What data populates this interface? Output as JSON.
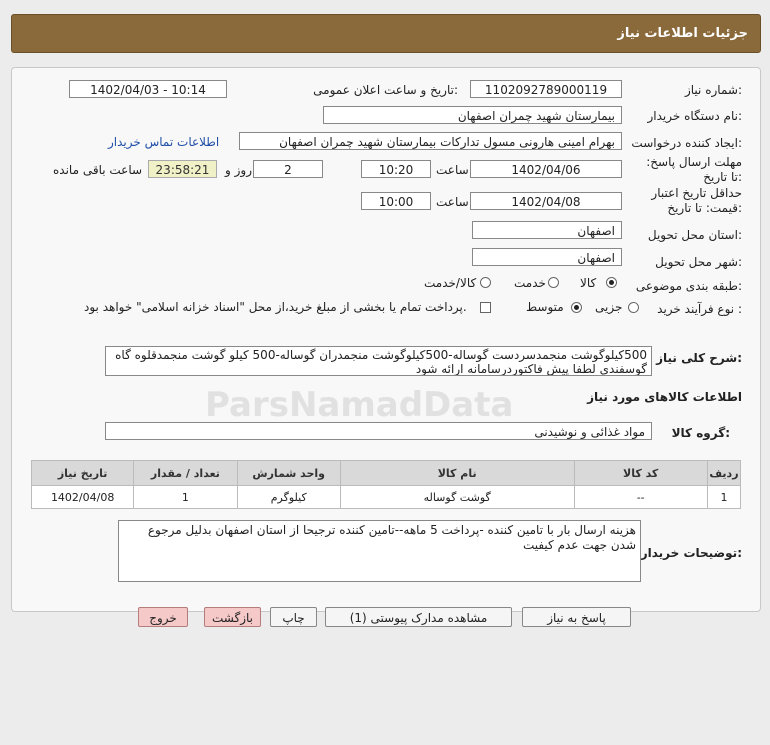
{
  "header": {
    "title": "جزئیات اطلاعات نیاز"
  },
  "form": {
    "need_number": {
      "label": "شماره نیاز:",
      "value": "1102092789000119"
    },
    "announce": {
      "label": "تاریخ و ساعت اعلان عمومی:",
      "value": "1402/04/03 - 10:14"
    },
    "buyer_org": {
      "label": "نام دستگاه خریدار:",
      "value": "بیمارستان شهید چمران اصفهان"
    },
    "requester": {
      "label": "ایجاد کننده درخواست:",
      "value": "بهرام امینی هارونی مسول تدارکات بیمارستان شهید چمران اصفهان",
      "contact_link": "اطلاعات تماس خریدار"
    },
    "reply_deadline": {
      "label": "مهلت ارسال پاسخ: تا تاریخ:",
      "date": "1402/04/06",
      "time_label": "ساعت",
      "time": "10:20",
      "days": "2",
      "days_label": "روز و",
      "remaining": "23:58:21",
      "remaining_label": "ساعت باقی مانده"
    },
    "price_validity": {
      "label": "حداقل تاریخ اعتبار قیمت: تا تاریخ:",
      "date": "1402/04/08",
      "time_label": "ساعت",
      "time": "10:00"
    },
    "delivery_province": {
      "label": "استان محل تحویل:",
      "value": "اصفهان"
    },
    "delivery_city": {
      "label": "شهر محل تحویل:",
      "value": "اصفهان"
    },
    "category": {
      "label": "طبقه بندی موضوعی:",
      "options": [
        "کالا",
        "خدمت",
        "کالا/خدمت"
      ],
      "selected": "کالا"
    },
    "purchase_type": {
      "label": "نوع فرآیند خرید :",
      "options": [
        "جزیی",
        "متوسط"
      ],
      "selected": "متوسط",
      "payment_note": "پرداخت تمام یا بخشی از مبلغ خرید،از محل \"اسناد خزانه اسلامی\" خواهد بود."
    }
  },
  "description": {
    "label": "شرح کلی نیاز:",
    "text": "500کیلوگوشت منجمدسردست گوساله-500کیلوگوشت منجمدران گوساله-500 کیلو گوشت منجمدقلوه گاه گوسفندی لطفا پیش فاکتوردرسامانه ارائه شود"
  },
  "goods": {
    "section_title": "اطلاعات کالاهای مورد نیاز",
    "group_label": "گروه کالا:",
    "group_value": "مواد غذائی و نوشیدنی",
    "columns": [
      "ردیف",
      "کد کالا",
      "نام کالا",
      "واحد شمارش",
      "تعداد / مقدار",
      "تاریخ نیاز"
    ],
    "rows": [
      {
        "row": "1",
        "code": "--",
        "name": "گوشت گوساله",
        "unit": "کیلوگرم",
        "qty": "1",
        "date": "1402/04/08"
      }
    ]
  },
  "buyer_notes": {
    "label": "توضیحات خریدار:",
    "text": "هزینه ارسال بار با تامین کننده -پرداخت 5 ماهه--تامین کننده ترجیحا از استان اصفهان بدلیل مرجوع شدن جهت عدم کیفیت"
  },
  "buttons": {
    "reply": "پاسخ به نیاز",
    "attachments": "مشاهده مدارک پیوستی (1)",
    "print": "چاپ",
    "back": "بازگشت",
    "exit": "خروج"
  },
  "watermark": {
    "brand": "ParsNamadData"
  }
}
